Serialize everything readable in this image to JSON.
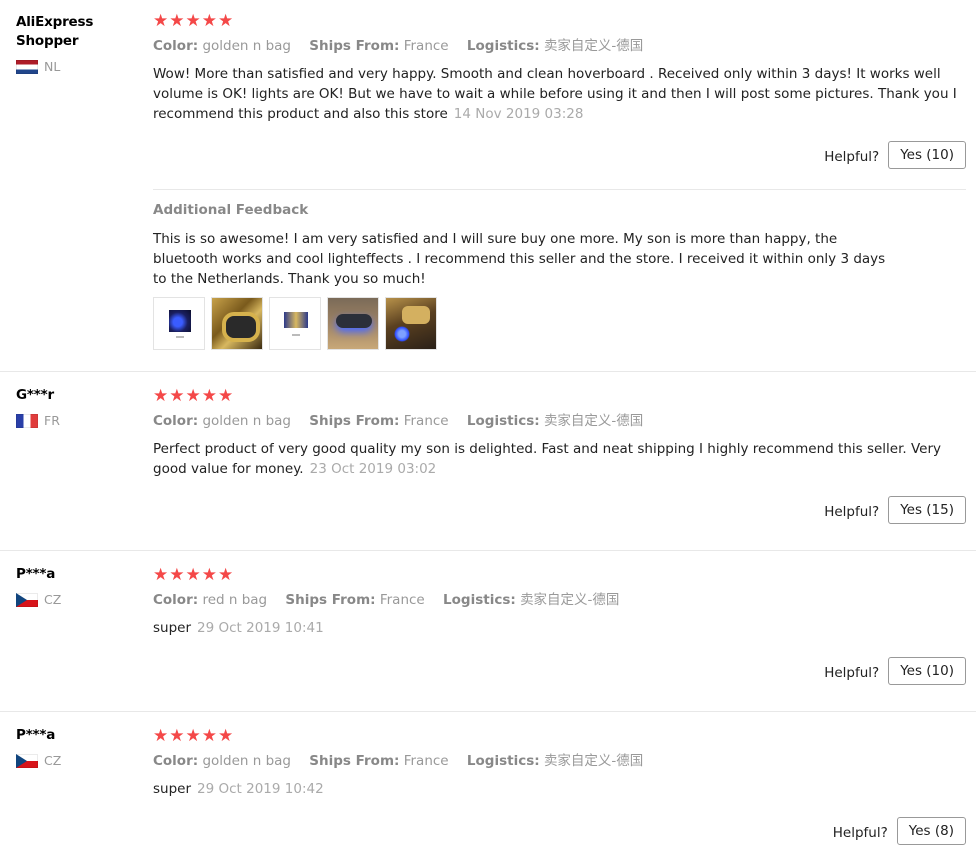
{
  "labels": {
    "color": "Color:",
    "ships_from": "Ships From:",
    "logistics": "Logistics:",
    "helpful": "Helpful?",
    "additional_feedback": "Additional Feedback"
  },
  "colors": {
    "star": "#f44848",
    "muted": "#999999",
    "date": "#aaaaaa"
  },
  "reviews": [
    {
      "user": "AliExpress Shopper",
      "country": "NL",
      "stars": "★★★★★",
      "color": "golden n bag",
      "ships_from": "France",
      "logistics": "卖家自定义-德国",
      "content": "Wow! More than satisfied and very happy. Smooth and clean hoverboard . Received only within 3 days! It works well volume is OK! lights are OK! But we have to wait a while before using it and then I will post some pictures. Thank you I recommend this product and also this store",
      "date": "14 Nov 2019 03:28",
      "helpful_button": "Yes (10)",
      "additional_feedback": "This is so awesome! I am very satisfied and I will sure buy one more. My son is more than happy, the bluetooth works and cool lighteffects . I recommend this seller and the store. I received it within only 3 days to the Netherlands. Thank you so much!",
      "photos": [
        "photo-1",
        "photo-2",
        "photo-3",
        "photo-4",
        "photo-5"
      ]
    },
    {
      "user": "G***r",
      "country": "FR",
      "stars": "★★★★★",
      "color": "golden n bag",
      "ships_from": "France",
      "logistics": "卖家自定义-德国",
      "content": "Perfect product of very good quality my son is delighted. Fast and neat shipping I highly recommend this seller. Very good value for money.",
      "date": "23 Oct 2019 03:02",
      "helpful_button": "Yes (15)"
    },
    {
      "user": "P***a",
      "country": "CZ",
      "stars": "★★★★★",
      "color": "red n bag",
      "ships_from": "France",
      "logistics": "卖家自定义-德国",
      "content": "super",
      "date": "29 Oct 2019 10:41",
      "helpful_button": "Yes (10)"
    },
    {
      "user": "P***a",
      "country": "CZ",
      "stars": "★★★★★",
      "color": "golden n bag",
      "ships_from": "France",
      "logistics": "卖家自定义-德国",
      "content": "super",
      "date": "29 Oct 2019 10:42",
      "helpful_button": "Yes (8)"
    }
  ]
}
